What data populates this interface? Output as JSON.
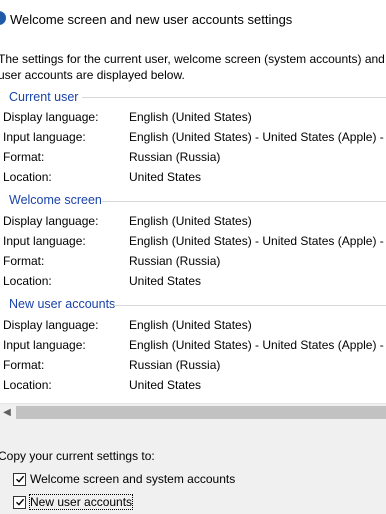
{
  "window": {
    "title": "Welcome screen and new user accounts settings"
  },
  "intro": {
    "line1": "The settings for the current user, welcome screen (system accounts) and n",
    "line2": "user accounts are displayed below."
  },
  "sections": [
    {
      "header": "Current user",
      "rows": [
        {
          "label": "Display language:",
          "value": "English (United States)"
        },
        {
          "label": "Input language:",
          "value": "English (United States) - United States (Apple) - P"
        },
        {
          "label": "Format:",
          "value": "Russian (Russia)"
        },
        {
          "label": "Location:",
          "value": "United States"
        }
      ]
    },
    {
      "header": "Welcome screen",
      "rows": [
        {
          "label": "Display language:",
          "value": "English (United States)"
        },
        {
          "label": "Input language:",
          "value": "English (United States) - United States (Apple) - P"
        },
        {
          "label": "Format:",
          "value": "Russian (Russia)"
        },
        {
          "label": "Location:",
          "value": "United States"
        }
      ]
    },
    {
      "header": "New user accounts",
      "rows": [
        {
          "label": "Display language:",
          "value": "English (United States)"
        },
        {
          "label": "Input language:",
          "value": "English (United States) - United States (Apple) - P"
        },
        {
          "label": "Format:",
          "value": "Russian (Russia)"
        },
        {
          "label": "Location:",
          "value": "United States"
        }
      ]
    }
  ],
  "copy_settings": {
    "label": "Copy your current settings to:",
    "options": [
      {
        "label": "Welcome screen and system accounts",
        "checked": true
      },
      {
        "label": "New user accounts",
        "checked": true
      }
    ]
  },
  "colors": {
    "section_header": "#1a44a8",
    "window_icon": "#1e5aa8"
  }
}
